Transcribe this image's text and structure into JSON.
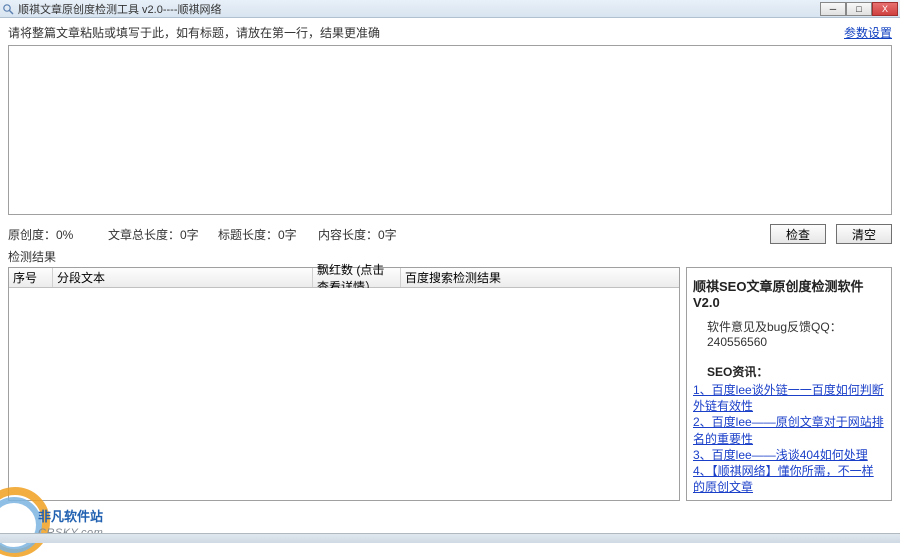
{
  "window": {
    "title": "顺祺文章原创度检测工具  v2.0----顺祺网络",
    "minimize": "─",
    "maximize": "□",
    "close": "X"
  },
  "top": {
    "prompt": "请将整篇文章粘贴或填写于此，如有标题，请放在第一行，结果更准确",
    "param_link": "参数设置"
  },
  "editor": {
    "value": ""
  },
  "stats": {
    "originality": "原创度：0%",
    "total_len": "文章总长度：0字",
    "title_len": "标题长度：0字",
    "body_len": "内容长度：0字"
  },
  "buttons": {
    "check": "检查",
    "clear": "清空"
  },
  "results": {
    "label": "检测结果",
    "columns": {
      "c1": "序号",
      "c2": "分段文本",
      "c3": "飘红数 (点击查看详情）",
      "c4": "百度搜索检测结果"
    }
  },
  "side": {
    "title": "顺祺SEO文章原创度检测软件V2.0",
    "feedback": "软件意见及bug反馈QQ：240556560",
    "seo_head": "SEO资讯：",
    "links": [
      "1、百度lee谈外链一一百度如何判断外链有效性",
      "2、百度lee——原创文章对于网站排名的重要性",
      "3、百度lee——浅谈404如何处理",
      "4、【顺祺网络】懂你所需，不一样的原创文章"
    ]
  },
  "watermark": {
    "t1": "非凡软件站",
    "t2": "CRSKY.com"
  }
}
